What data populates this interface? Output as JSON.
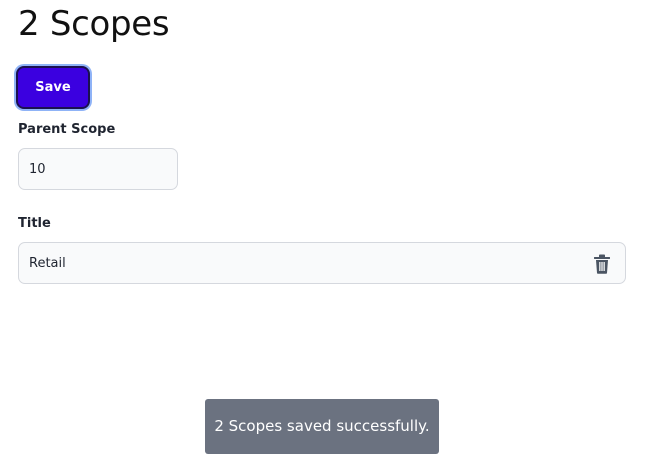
{
  "page": {
    "title": "2 Scopes"
  },
  "actions": {
    "save_label": "Save"
  },
  "form": {
    "parent_scope": {
      "label": "Parent Scope",
      "value": "10"
    },
    "title": {
      "label": "Title",
      "value": "Retail",
      "delete_icon": "trash-icon"
    }
  },
  "toast": {
    "message": "2 Scopes saved successfully."
  },
  "colors": {
    "primary": "#3b00e0",
    "toast_bg": "#6b7280",
    "input_bg": "#f9fafb"
  }
}
